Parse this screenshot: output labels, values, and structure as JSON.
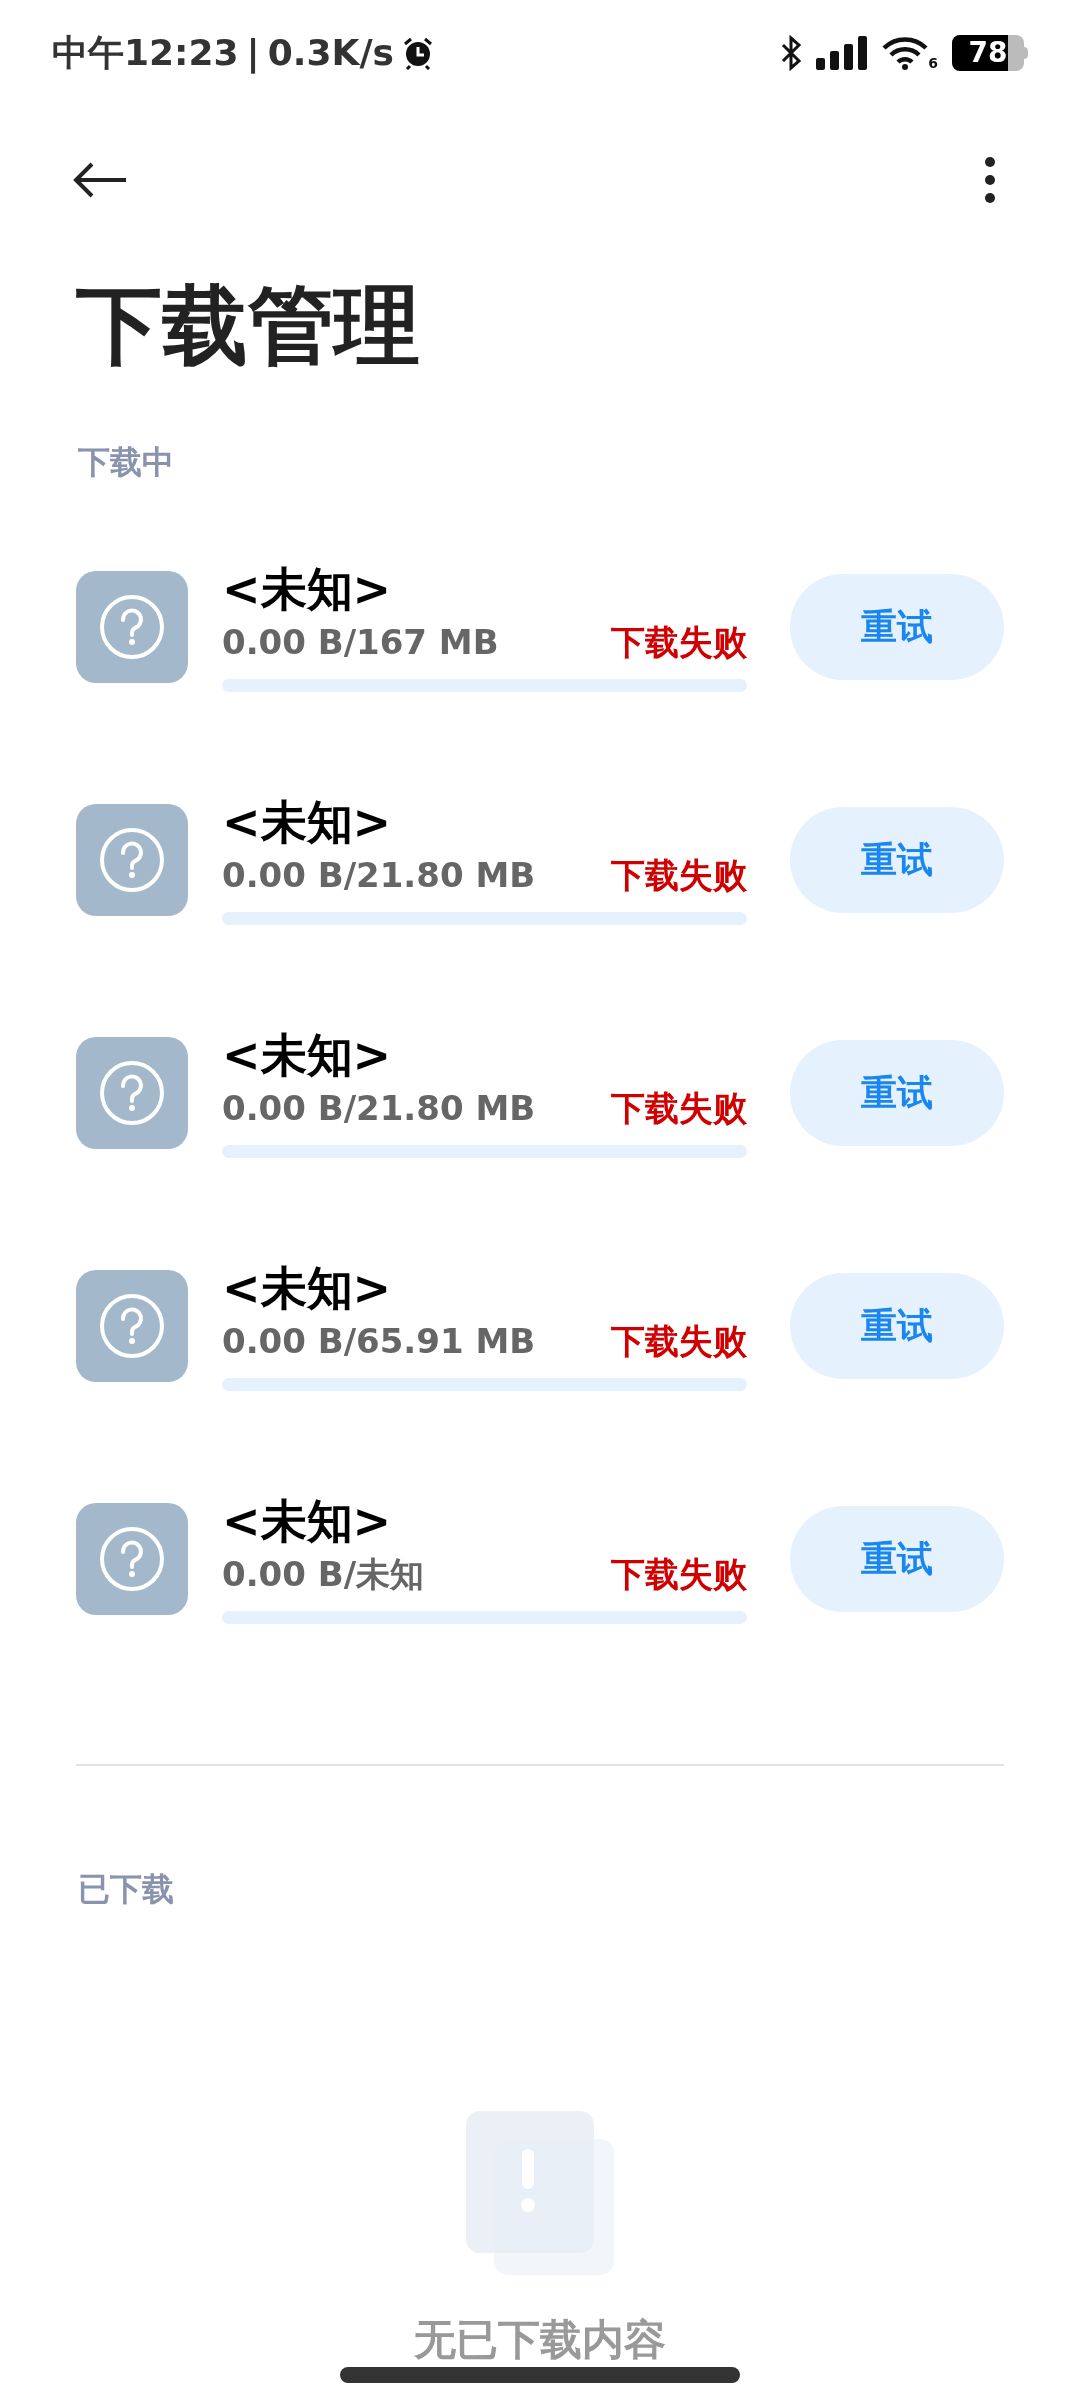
{
  "status_bar": {
    "time": "中午12:23",
    "separator": "|",
    "speed": "0.3K/s",
    "wifi_badge": "6",
    "battery": "78"
  },
  "title": "下载管理",
  "downloading": {
    "label": "下载中",
    "items": [
      {
        "name": "<未知>",
        "size": "0.00 B/167 MB",
        "status": "下载失败",
        "level": 0,
        "action": "重试"
      },
      {
        "name": "<未知>",
        "size": "0.00 B/21.80 MB",
        "status": "下载失败",
        "level": 0,
        "action": "重试"
      },
      {
        "name": "<未知>",
        "size": "0.00 B/21.80 MB",
        "status": "下载失败",
        "level": 0,
        "action": "重试"
      },
      {
        "name": "<未知>",
        "size": "0.00 B/65.91 MB",
        "status": "下载失败",
        "level": 0,
        "action": "重试"
      },
      {
        "name": "<未知>",
        "size": "0.00 B/未知",
        "status": "下载失败",
        "level": 0,
        "action": "重试"
      }
    ]
  },
  "downloaded": {
    "label": "已下载",
    "empty_text": "无已下载内容"
  }
}
